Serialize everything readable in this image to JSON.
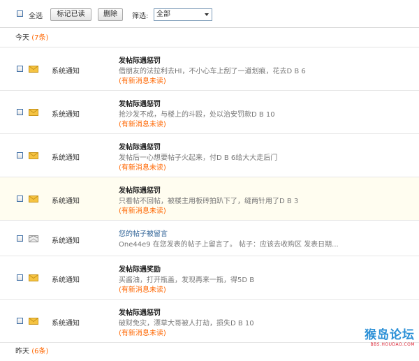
{
  "toolbar": {
    "select_all_label": "全选",
    "mark_read_label": "标记已读",
    "delete_label": "删除",
    "filter_label": "筛选:",
    "filter_value": "全部"
  },
  "sections": {
    "today": {
      "label": "今天",
      "count": "(7条)"
    },
    "yesterday": {
      "label": "昨天",
      "count": "(6条)"
    }
  },
  "unread_label": "(有新消息未读)",
  "messages": [
    {
      "sender": "系统通知",
      "title": "发帖际遇惩罚",
      "body": "借朋友的法拉利去HI，不小心车上刮了一道划痕，花去D B 6",
      "unread": true,
      "icon": "mail-unread-icon"
    },
    {
      "sender": "系统通知",
      "title": "发帖际遇惩罚",
      "body": "抢沙发不成，与楼上的斗殴，处以治安罚款D B 10",
      "unread": true,
      "icon": "mail-unread-icon"
    },
    {
      "sender": "系统通知",
      "title": "发帖际遇惩罚",
      "body": "发帖后一心想要帖子火起来，付D B 6给大大走后门",
      "unread": true,
      "icon": "mail-unread-icon"
    },
    {
      "sender": "系统通知",
      "title": "发帖际遇惩罚",
      "body": "只看帖不回帖，被楼主用板砖拍趴下了，缝两针用了D B 3",
      "unread": true,
      "icon": "mail-unread-icon"
    },
    {
      "sender": "系统通知",
      "title": "您的帖子被留言",
      "body": "One44e9 在您发表的帖子上留言了。 帖子：应该去收购区 发表日期...",
      "unread": false,
      "icon": "mail-read-icon"
    },
    {
      "sender": "系统通知",
      "title": "发帖际遇奖励",
      "body": "买酱油，打开瓶盖，发现再来一瓶，得5D B",
      "unread": true,
      "icon": "mail-unread-icon"
    },
    {
      "sender": "系统通知",
      "title": "发帖际遇惩罚",
      "body": "破财免灾，漂草大哥被人打劫，损失D B 10",
      "unread": true,
      "icon": "mail-unread-icon"
    }
  ],
  "watermark": {
    "text": "猴岛论坛",
    "sub": "BBS.HOUDAO.COM"
  },
  "colors": {
    "accent": "#ff6600",
    "link": "#336699",
    "highlight_row": "#fffdf0"
  }
}
